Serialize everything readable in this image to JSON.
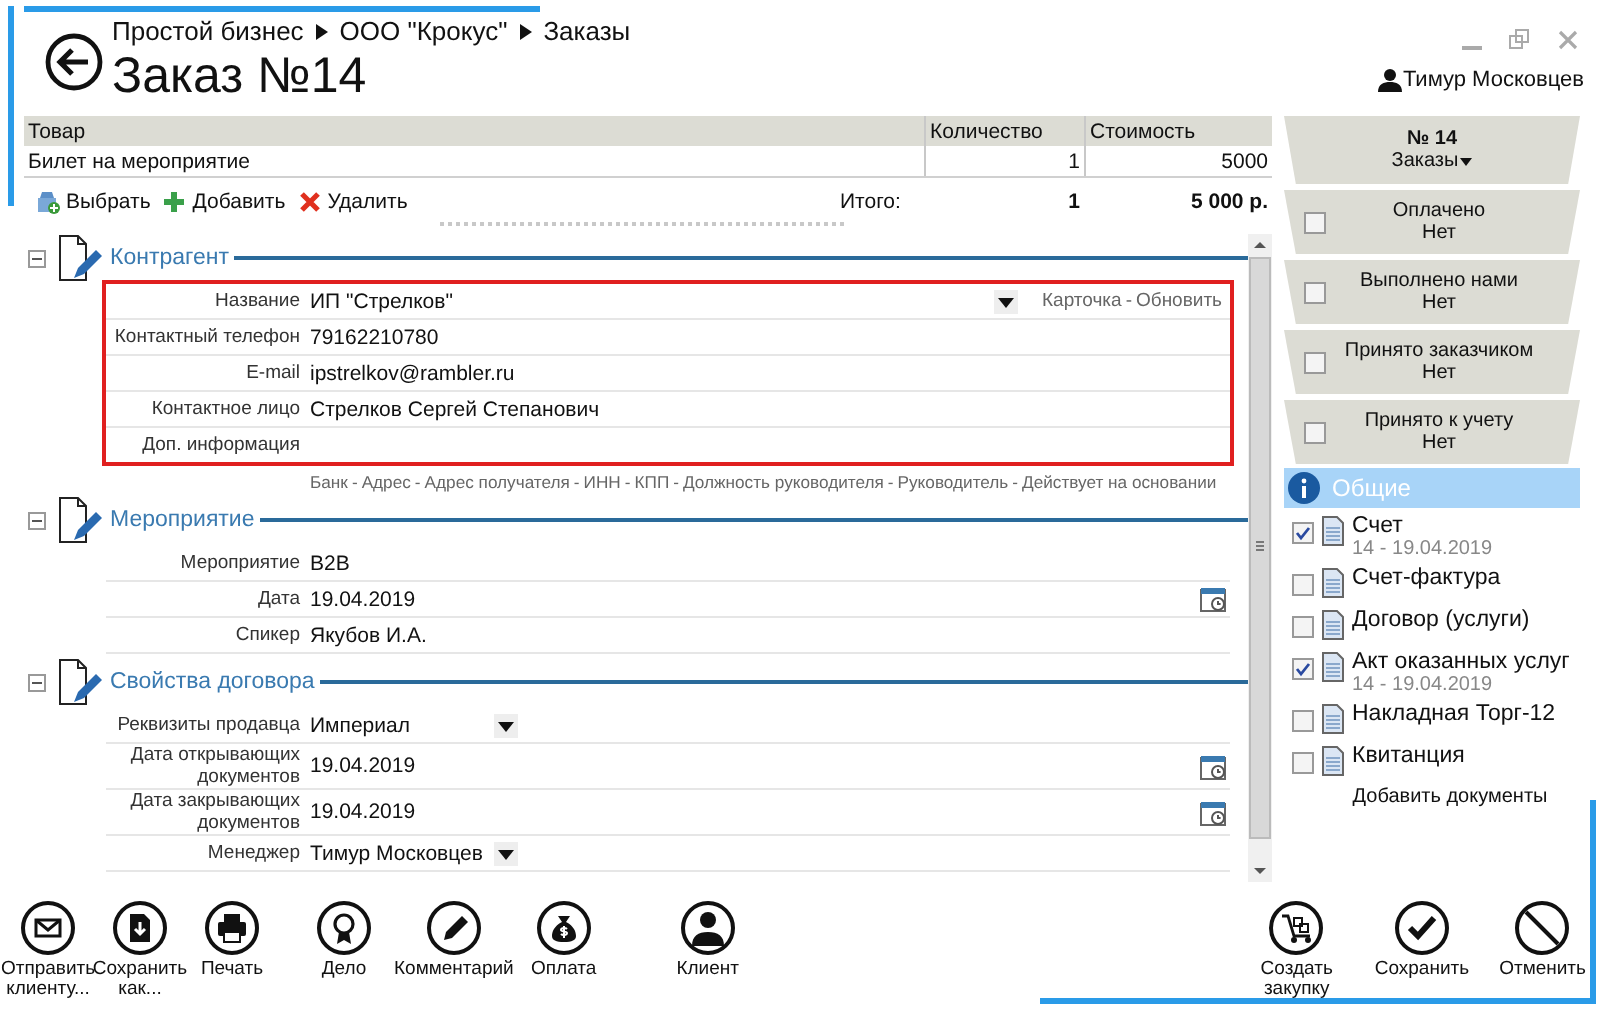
{
  "window": {
    "breadcrumb": [
      "Простой бизнес",
      "ООО \"Крокус\"",
      "Заказы"
    ],
    "title": "Заказ №14",
    "user": "Тимур Московцев"
  },
  "items": {
    "columns": [
      "Товар",
      "Количество",
      "Стоимость"
    ],
    "rows": [
      [
        "Билет на мероприятие",
        "1",
        "5000"
      ]
    ],
    "actions": [
      {
        "label": "Выбрать",
        "kind": "pick"
      },
      {
        "label": "Добавить",
        "kind": "add"
      },
      {
        "label": "Удалить",
        "kind": "delete"
      }
    ],
    "total_label": "Итого:",
    "total_qty": "1",
    "total_sum": "5 000 р."
  },
  "sections": [
    {
      "title": "Контрагент",
      "highlighted": true,
      "fields": [
        {
          "label": "Название",
          "value": "ИП \"Стрелков\"",
          "kind": "select",
          "links": [
            {
              "text": "Карточка",
              "separator": "-"
            },
            {
              "text": "Обновить"
            }
          ]
        },
        {
          "label": "Контактный телефон",
          "value": "79162210780",
          "kind": "text"
        },
        {
          "label": "E-mail",
          "value": "ipstrelkov@rambler.ru",
          "kind": "text"
        },
        {
          "label": "Контактное лицо",
          "value": "Стрелков Сергей Степанович",
          "kind": "text"
        },
        {
          "label": "Доп. информация",
          "kind": "text"
        }
      ],
      "links": [
        {
          "text": "Банк",
          "separator": "-"
        },
        {
          "text": "Адрес",
          "separator": "-"
        },
        {
          "text": "Адрес получателя",
          "separator": "-"
        },
        {
          "text": "ИНН",
          "separator": "-"
        },
        {
          "text": "КПП",
          "separator": "-"
        },
        {
          "text": "Должность руководителя",
          "separator": "-"
        },
        {
          "text": "Руководитель",
          "separator": "-"
        },
        {
          "text": "Действует на основании"
        }
      ]
    },
    {
      "title": "Мероприятие",
      "highlighted": false,
      "fields": [
        {
          "label": "Мероприятие",
          "value": "B2B",
          "kind": "text"
        },
        {
          "label": "Дата",
          "value": "19.04.2019",
          "kind": "date"
        },
        {
          "label": "Спикер",
          "value": "Якубов И.А.",
          "kind": "text"
        }
      ]
    },
    {
      "title": "Свойства договора",
      "highlighted": false,
      "fields": [
        {
          "label": "Реквизиты продавца",
          "value": "Империал",
          "kind": "dropdown"
        },
        {
          "label": "Дата открывающих документов",
          "value": "19.04.2019",
          "kind": "date"
        },
        {
          "label": "Дата закрывающих документов",
          "value": "19.04.2019",
          "kind": "date"
        },
        {
          "label": "Менеджер",
          "value": "Тимур Московцев",
          "kind": "dropdown"
        }
      ]
    }
  ],
  "order_card": {
    "number": "№ 14",
    "menu": "Заказы"
  },
  "status": [
    {
      "label": "Оплачено",
      "value": "Нет",
      "checked": false
    },
    {
      "label": "Выполнено нами",
      "value": "Нет",
      "checked": false
    },
    {
      "label": "Принято заказчиком",
      "value": "Нет",
      "checked": false
    },
    {
      "label": "Принято к учету",
      "value": "Нет",
      "checked": false
    }
  ],
  "documents": {
    "group": "Общие",
    "items": [
      {
        "name": "Счет",
        "detail": "14 - 19.04.2019",
        "checked": true
      },
      {
        "name": "Счет-фактура",
        "checked": false
      },
      {
        "name": "Договор (услуги)",
        "checked": false
      },
      {
        "name": "Акт оказанных услуг",
        "detail": "14 - 19.04.2019",
        "checked": true
      },
      {
        "name": "Накладная Торг-12",
        "checked": false
      },
      {
        "name": "Квитанция",
        "checked": false
      }
    ],
    "add_label": "Добавить документы"
  },
  "toolbar_left": [
    {
      "label": "Отправить клиенту...",
      "kind": "mail"
    },
    {
      "label": "Сохранить как...",
      "kind": "save"
    },
    {
      "label": "Печать",
      "kind": "print"
    },
    {
      "label": "Дело",
      "kind": "case"
    },
    {
      "label": "Комментарий",
      "kind": "comment"
    },
    {
      "label": "Оплата",
      "kind": "payment"
    },
    {
      "label": "Клиент",
      "kind": "client"
    }
  ],
  "toolbar_right": [
    {
      "label": "Создать закупку",
      "kind": "purchase"
    },
    {
      "label": "Сохранить",
      "kind": "ok"
    },
    {
      "label": "Отменить",
      "kind": "cancel"
    }
  ]
}
